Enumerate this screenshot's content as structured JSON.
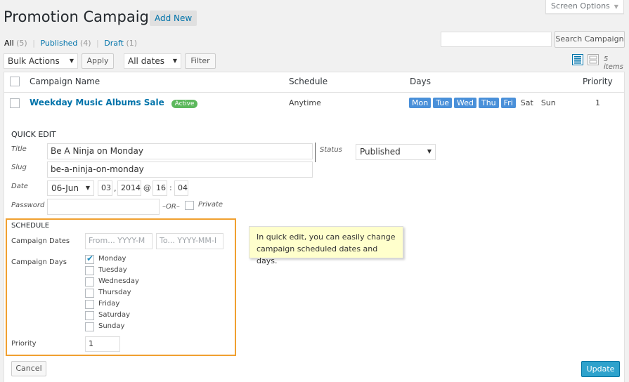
{
  "header": {
    "title": "Promotion Campaigns",
    "add_new": "Add New",
    "screen_options": "Screen Options"
  },
  "filters": {
    "all": "All",
    "all_count": "(5)",
    "published": "Published",
    "published_count": "(4)",
    "draft": "Draft",
    "draft_count": "(1)",
    "sep": "|"
  },
  "search": {
    "button": "Search Campaign",
    "value": ""
  },
  "toolbar": {
    "bulk_actions": "Bulk Actions",
    "apply": "Apply",
    "all_dates": "All dates",
    "filter": "Filter",
    "items_count": "5 items"
  },
  "table": {
    "headers": {
      "name": "Campaign Name",
      "schedule": "Schedule",
      "days": "Days",
      "priority": "Priority"
    },
    "row": {
      "name": "Weekday Music Albums Sale",
      "badge": "Active",
      "schedule": "Anytime",
      "days": [
        {
          "label": "Mon",
          "active": true
        },
        {
          "label": "Tue",
          "active": true
        },
        {
          "label": "Wed",
          "active": true
        },
        {
          "label": "Thu",
          "active": true
        },
        {
          "label": "Fri",
          "active": true
        },
        {
          "label": "Sat",
          "active": false
        },
        {
          "label": "Sun",
          "active": false
        }
      ],
      "priority": "1"
    }
  },
  "quick_edit": {
    "heading": "QUICK EDIT",
    "title_label": "Title",
    "title_value": "Be A Ninja on Monday",
    "slug_label": "Slug",
    "slug_value": "be-a-ninja-on-monday",
    "date_label": "Date",
    "date_month": "06-Jun",
    "date_day": "03",
    "date_comma": ",",
    "date_year": "2014",
    "date_at": "@",
    "date_hour": "16",
    "date_colon": ":",
    "date_min": "04",
    "password_label": "Password",
    "or_label": "–OR–",
    "private_label": "Private",
    "status_label": "Status",
    "status_value": "Published"
  },
  "schedule": {
    "heading": "SCHEDULE",
    "dates_label": "Campaign Dates",
    "from_placeholder": "From... YYYY-M",
    "to_placeholder": "To... YYYY-MM-I",
    "days_label": "Campaign Days",
    "days": [
      {
        "label": "Monday",
        "checked": true
      },
      {
        "label": "Tuesday",
        "checked": false
      },
      {
        "label": "Wednesday",
        "checked": false
      },
      {
        "label": "Thursday",
        "checked": false
      },
      {
        "label": "Friday",
        "checked": false
      },
      {
        "label": "Saturday",
        "checked": false
      },
      {
        "label": "Sunday",
        "checked": false
      }
    ],
    "priority_label": "Priority",
    "priority_value": "1"
  },
  "tooltip": "In quick edit, you can easily change campaign scheduled dates and days.",
  "actions": {
    "cancel": "Cancel",
    "update": "Update"
  },
  "colors": {
    "accent": "#0073aa",
    "active_badge": "#5cb85c",
    "day_on": "#4a90d9",
    "schedule_border": "#f0a030",
    "update_button": "#2ea2cc"
  }
}
